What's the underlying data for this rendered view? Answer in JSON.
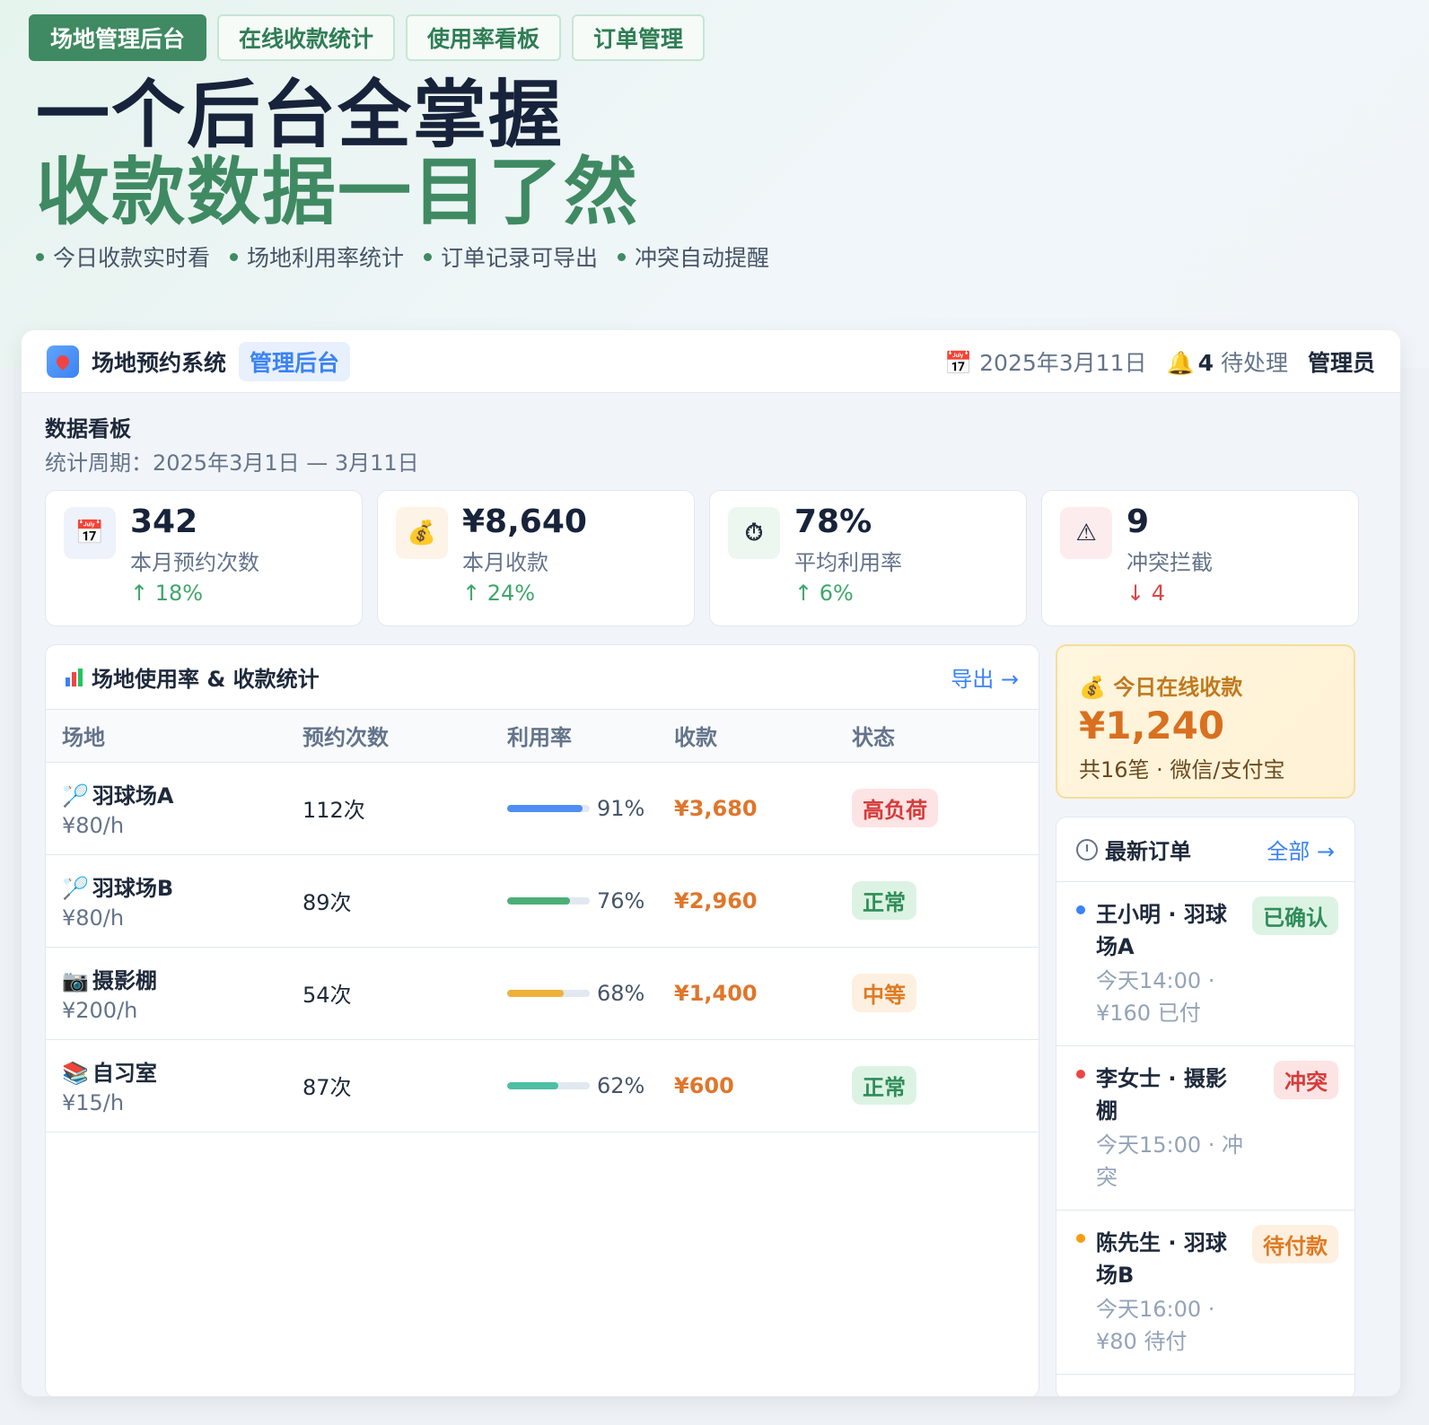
{
  "hero": {
    "tabs": [
      "场地管理后台",
      "在线收款统计",
      "使用率看板",
      "订单管理"
    ],
    "headline_1": "一个后台全掌握",
    "headline_2": "收款数据一目了然",
    "features": [
      "今日收款实时看",
      "场地利用率统计",
      "订单记录可导出",
      "冲突自动提醒"
    ]
  },
  "topbar": {
    "app_name": "场地预约系统",
    "badge": "管理后台",
    "date": "📅 2025年3月11日",
    "bell_icon": "🔔",
    "pending_count": "4",
    "pending_label": " 待处理",
    "admin": "管理员"
  },
  "dashboard": {
    "title": "数据看板",
    "period": "统计周期：2025年3月1日 — 3月11日"
  },
  "stats": [
    {
      "icon": "📅",
      "icon_name": "calendar-icon",
      "value": "342",
      "label": "本月预约次数",
      "change": "↑ 18%",
      "trend": "up",
      "icon_bg": "#eef2fb"
    },
    {
      "icon": "💰",
      "icon_name": "money-bag-icon",
      "value": "¥8,640",
      "label": "本月收款",
      "change": "↑ 24%",
      "trend": "up",
      "icon_bg": "#fdf3e6"
    },
    {
      "icon": "⏱",
      "icon_name": "stopwatch-icon",
      "value": "78%",
      "label": "平均利用率",
      "change": "↑ 6%",
      "trend": "up",
      "icon_bg": "#ecf7ef"
    },
    {
      "icon": "⚠",
      "icon_name": "warning-icon",
      "value": "9",
      "label": "冲突拦截",
      "change": "↓ 4",
      "trend": "down",
      "icon_bg": "#fdecee"
    }
  ],
  "table": {
    "title": "场地使用率 & 收款统计",
    "export": "导出 →",
    "headers": [
      "场地",
      "预约次数",
      "利用率",
      "收款",
      "状态"
    ],
    "rows": [
      {
        "icon": "🏸",
        "name": "羽球场A",
        "price": "¥80/h",
        "count": "112次",
        "pct": 91,
        "pct_label": "91%",
        "money": "¥3,680",
        "status": "高负荷",
        "bar_color": "#4f8ef2",
        "pill_bg": "#fde4e4",
        "pill_fg": "#d63b3b"
      },
      {
        "icon": "🏸",
        "name": "羽球场B",
        "price": "¥80/h",
        "count": "89次",
        "pct": 76,
        "pct_label": "76%",
        "money": "¥2,960",
        "status": "正常",
        "bar_color": "#4caf78",
        "pill_bg": "#dcf3e4",
        "pill_fg": "#2f8d58"
      },
      {
        "icon": "📷",
        "name": "摄影棚",
        "price": "¥200/h",
        "count": "54次",
        "pct": 68,
        "pct_label": "68%",
        "money": "¥1,400",
        "status": "中等",
        "bar_color": "#eeb13a",
        "pill_bg": "#fdf0e0",
        "pill_fg": "#df7a22"
      },
      {
        "icon": "📚",
        "name": "自习室",
        "price": "¥15/h",
        "count": "87次",
        "pct": 62,
        "pct_label": "62%",
        "money": "¥600",
        "status": "正常",
        "bar_color": "#4dbfa2",
        "pill_bg": "#dcf3e4",
        "pill_fg": "#2f8d58"
      }
    ]
  },
  "income": {
    "title": "💰 今日在线收款",
    "value": "¥1,240",
    "sub": "共16笔 · 微信/支付宝"
  },
  "orders": {
    "title": "最新订单",
    "all": "全部 →",
    "items": [
      {
        "name": "王小明 · 羽球场A",
        "meta": "今天14:00 · ¥160 已付",
        "status": "已确认",
        "dot": "#3b82f6",
        "pill_bg": "#dcf3e4",
        "pill_fg": "#2f8d58"
      },
      {
        "name": "李女士 · 摄影棚",
        "meta": "今天15:00 · 冲突",
        "status": "冲突",
        "dot": "#ef4444",
        "pill_bg": "#fde4e4",
        "pill_fg": "#d63b3b"
      },
      {
        "name": "陈先生 · 羽球场B",
        "meta": "今天16:00 · ¥80 待付",
        "status": "待付款",
        "dot": "#f59e0b",
        "pill_bg": "#fdf0e0",
        "pill_fg": "#df7a22"
      }
    ]
  }
}
